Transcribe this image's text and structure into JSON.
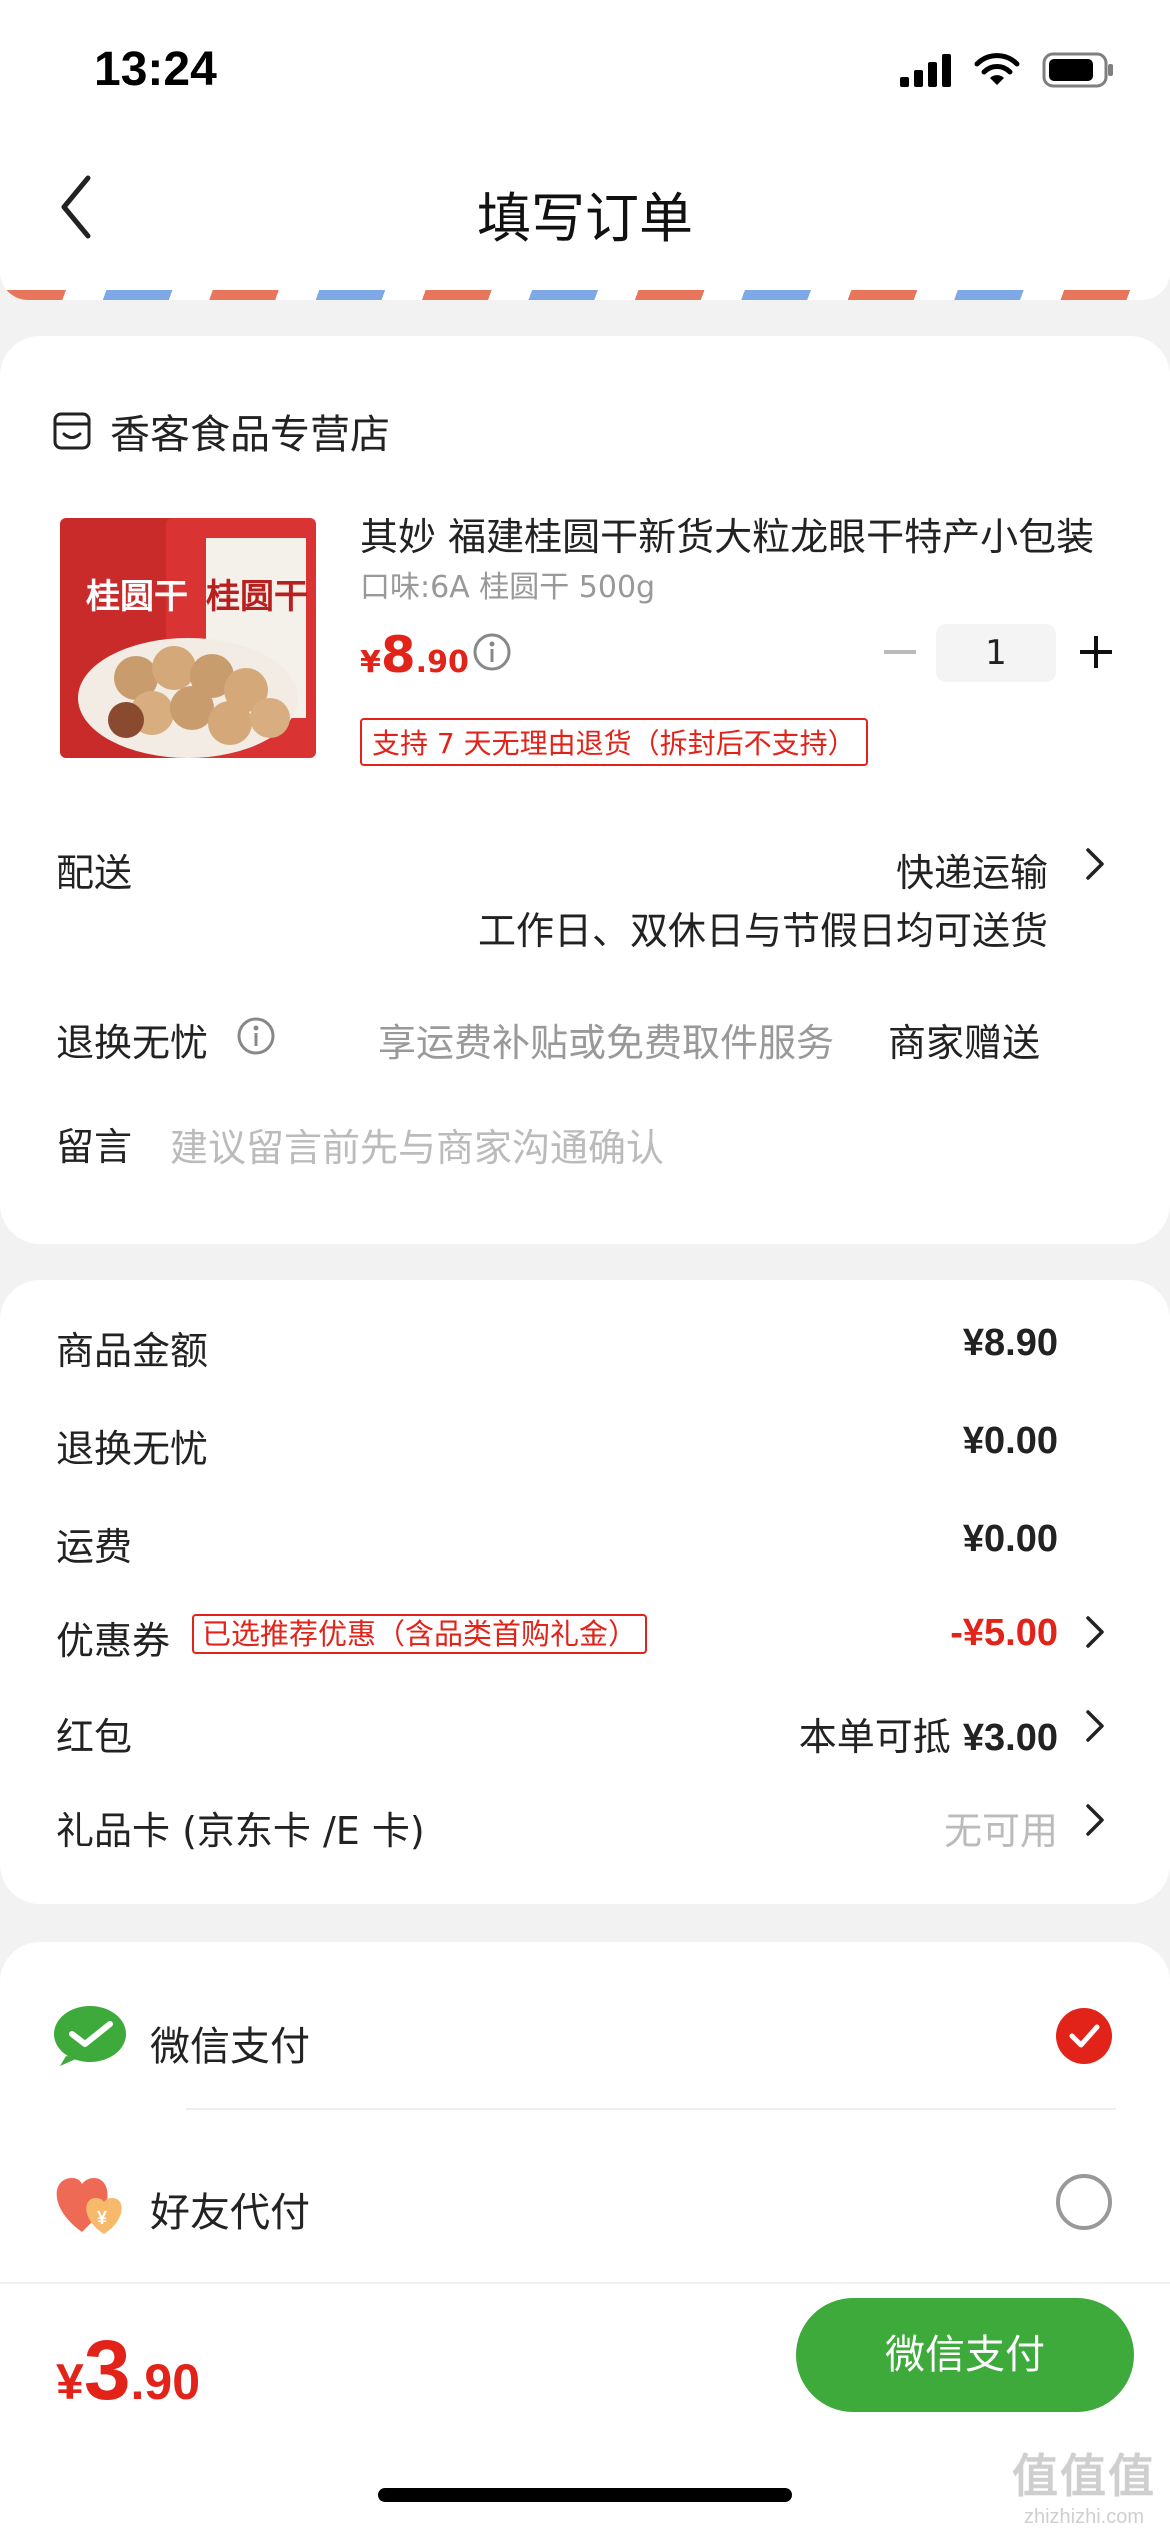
{
  "status_bar": {
    "time": "13:24"
  },
  "nav": {
    "title": "填写订单"
  },
  "store": {
    "name": "香客食品专营店"
  },
  "product": {
    "title": "其妙 福建桂圆干新货大粒龙眼干特产小包装",
    "spec": "口味:6A 桂圆干 500g",
    "price_currency": "¥",
    "price_int": "8",
    "price_dec": ".90",
    "quantity": "1",
    "return_policy": "支持 7 天无理由退货（拆封后不支持）",
    "image_text_left": "桂圆干",
    "image_text_right": "桂圆干"
  },
  "delivery": {
    "label": "配送",
    "method": "快递运输",
    "note": "工作日、双休日与节假日均可送货"
  },
  "worry_free": {
    "label": "退换无忧",
    "desc": "享运费补贴或免费取件服务",
    "value": "商家赠送"
  },
  "message": {
    "label": "留言",
    "placeholder": "建议留言前先与商家沟通确认"
  },
  "price_summary": {
    "goods_label": "商品金额",
    "goods_value": "¥8.90",
    "worry_label": "退换无忧",
    "worry_value": "¥0.00",
    "shipping_label": "运费",
    "shipping_value": "¥0.00",
    "coupon_label": "优惠券",
    "coupon_badge": "已选推荐优惠（含品类首购礼金）",
    "coupon_value": "-¥5.00",
    "redpacket_label": "红包",
    "redpacket_prefix": "本单可抵",
    "redpacket_value": "¥3.00",
    "giftcard_label": "礼品卡 (京东卡 /E 卡)",
    "giftcard_value": "无可用"
  },
  "payment": {
    "wechat_label": "微信支付",
    "friend_label": "好友代付",
    "selected": "wechat"
  },
  "bottom": {
    "total_currency": "¥",
    "total_int": "3",
    "total_dec": ".90",
    "pay_button": "微信支付"
  },
  "watermark": {
    "main": "值值值",
    "sub": "zhizhizhi.com"
  },
  "colors": {
    "accent_red": "#e2231a",
    "wechat_green": "#3daa3b",
    "airmail_red": "#e8765d",
    "airmail_blue": "#7ea8e6"
  }
}
